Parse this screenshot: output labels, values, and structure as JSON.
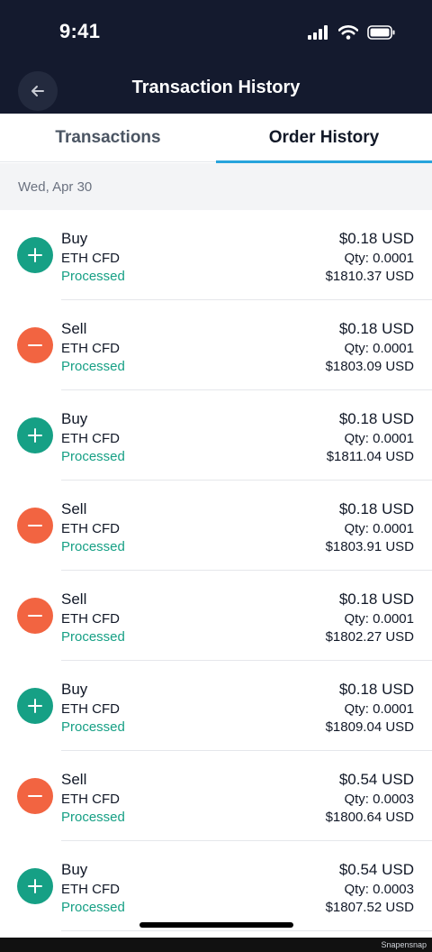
{
  "status_bar": {
    "time": "9:41"
  },
  "header": {
    "title": "Transaction History",
    "back_icon": "arrow-left-icon"
  },
  "tabs": [
    {
      "label": "Transactions",
      "active": false
    },
    {
      "label": "Order History",
      "active": true
    }
  ],
  "date_group": "Wed, Apr 30",
  "colors": {
    "header_bg": "#141a2e",
    "buy": "#16a085",
    "sell": "#f26441",
    "accent": "#27a3dc"
  },
  "orders": [
    {
      "type": "buy",
      "side": "Buy",
      "instrument": "ETH CFD",
      "status": "Processed",
      "amount": "$0.18 USD",
      "qty": "Qty: 0.0001",
      "price": "$1810.37 USD"
    },
    {
      "type": "sell",
      "side": "Sell",
      "instrument": "ETH CFD",
      "status": "Processed",
      "amount": "$0.18 USD",
      "qty": "Qty: 0.0001",
      "price": "$1803.09 USD"
    },
    {
      "type": "buy",
      "side": "Buy",
      "instrument": "ETH CFD",
      "status": "Processed",
      "amount": "$0.18 USD",
      "qty": "Qty: 0.0001",
      "price": "$1811.04 USD"
    },
    {
      "type": "sell",
      "side": "Sell",
      "instrument": "ETH CFD",
      "status": "Processed",
      "amount": "$0.18 USD",
      "qty": "Qty: 0.0001",
      "price": "$1803.91 USD"
    },
    {
      "type": "sell",
      "side": "Sell",
      "instrument": "ETH CFD",
      "status": "Processed",
      "amount": "$0.18 USD",
      "qty": "Qty: 0.0001",
      "price": "$1802.27 USD"
    },
    {
      "type": "buy",
      "side": "Buy",
      "instrument": "ETH CFD",
      "status": "Processed",
      "amount": "$0.18 USD",
      "qty": "Qty: 0.0001",
      "price": "$1809.04 USD"
    },
    {
      "type": "sell",
      "side": "Sell",
      "instrument": "ETH CFD",
      "status": "Processed",
      "amount": "$0.54 USD",
      "qty": "Qty: 0.0003",
      "price": "$1800.64 USD"
    },
    {
      "type": "buy",
      "side": "Buy",
      "instrument": "ETH CFD",
      "status": "Processed",
      "amount": "$0.54 USD",
      "qty": "Qty: 0.0003",
      "price": "$1807.52 USD"
    }
  ],
  "watermark": "Snapensnap"
}
